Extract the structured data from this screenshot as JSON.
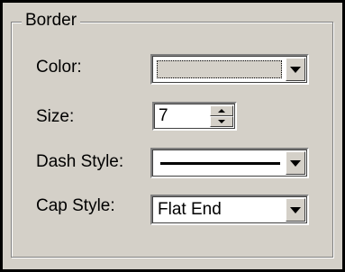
{
  "group": {
    "title": "Border"
  },
  "color": {
    "label": "Color:",
    "swatch_color": "#d4d0c8"
  },
  "size": {
    "label": "Size:",
    "value": "7"
  },
  "dash_style": {
    "label": "Dash Style:",
    "selected": "solid-line"
  },
  "cap_style": {
    "label": "Cap Style:",
    "value": "Flat End"
  },
  "icons": {
    "dropdown": "chevron-down-icon",
    "spin_up": "spin-up-icon",
    "spin_down": "spin-down-icon"
  }
}
